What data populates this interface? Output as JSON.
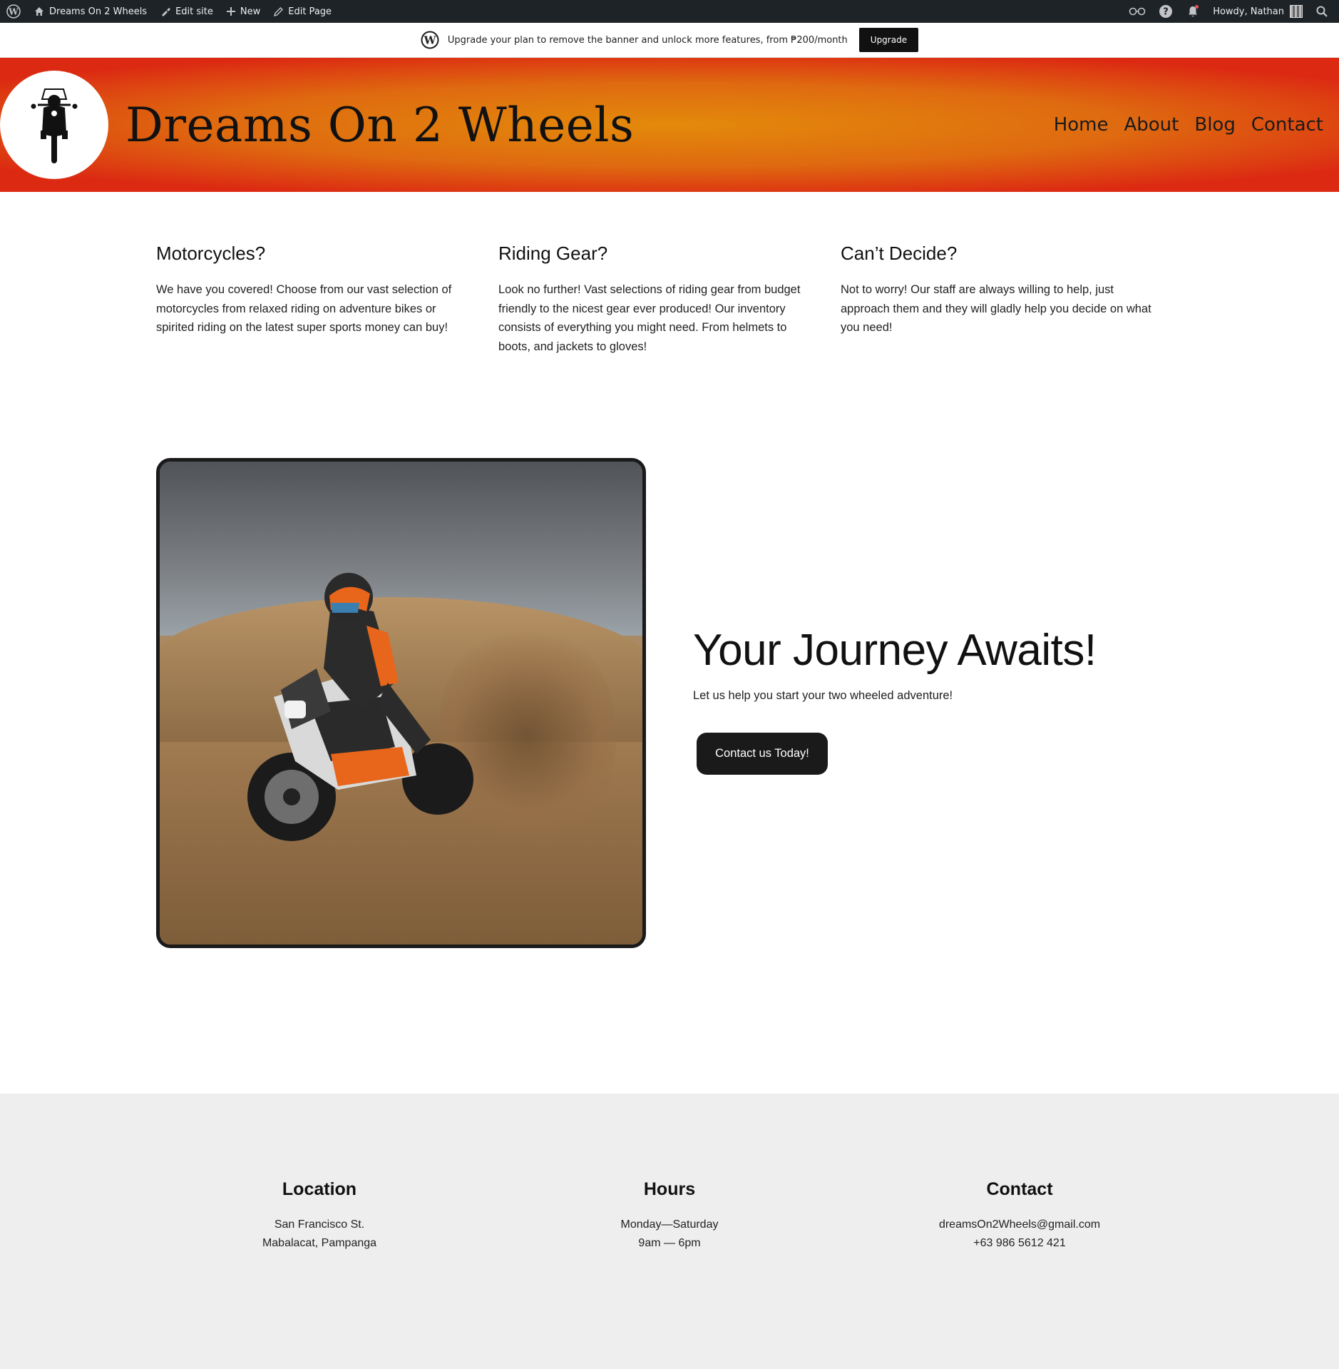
{
  "admin_bar": {
    "site_name": "Dreams On 2 Wheels",
    "edit_site": "Edit site",
    "new": "New",
    "edit_page": "Edit Page",
    "greeting": "Howdy, Nathan"
  },
  "banner": {
    "text": "Upgrade your plan to remove the banner and unlock more features, from ₱200/month",
    "button": "Upgrade"
  },
  "header": {
    "title": "Dreams On 2 Wheels",
    "nav": [
      "Home",
      "About",
      "Blog",
      "Contact"
    ],
    "colors": {
      "center": "#e38a0b",
      "edge": "#dc2a12"
    }
  },
  "features": [
    {
      "title": "Motorcycles?",
      "text": "We have you covered! Choose from our vast selection of motorcycles from relaxed riding on adventure bikes or spirited riding on the latest super sports money can buy!"
    },
    {
      "title": "Riding Gear?",
      "text": "Look no further! Vast selections of riding gear from budget friendly to the nicest gear ever produced! Our inventory consists of everything you might need. From helmets to boots, and jackets to gloves!"
    },
    {
      "title": "Can’t Decide?",
      "text": "Not to worry! Our staff are always willing to help, just approach them and they will gladly help you decide on what you need!"
    }
  ],
  "hero": {
    "title": "Your Journey Awaits!",
    "subtitle": "Let us help you start your two wheeled adventure!",
    "button": "Contact us Today!"
  },
  "footer": {
    "location": {
      "title": "Location",
      "line1": "San Francisco St.",
      "line2": "Mabalacat, Pampanga"
    },
    "hours": {
      "title": "Hours",
      "line1": "Monday—Saturday",
      "line2": "9am — 6pm"
    },
    "contact": {
      "title": "Contact",
      "line1": "dreamsOn2Wheels@gmail.com",
      "line2": "+63 986 5612 421"
    }
  }
}
